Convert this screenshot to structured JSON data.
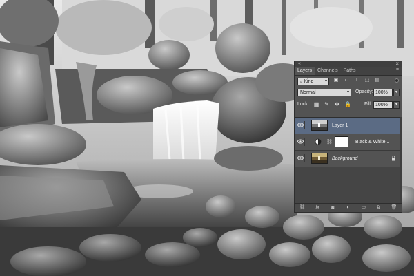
{
  "photo": {
    "subject": "waterfall-in-forest-bw"
  },
  "panel": {
    "tabs": [
      {
        "label": "Layers",
        "active": true
      },
      {
        "label": "Channels",
        "active": false
      },
      {
        "label": "Paths",
        "active": false
      }
    ],
    "filter": {
      "kind_label": "Kind"
    },
    "blend": {
      "mode": "Normal",
      "opacity_label": "Opacity:",
      "opacity_value": "100%"
    },
    "lock": {
      "label": "Lock:",
      "fill_label": "Fill:",
      "fill_value": "100%"
    },
    "layers": [
      {
        "name": "Layer 1",
        "selected": true,
        "visible": true,
        "thumb": "image"
      },
      {
        "name": "Black & White...",
        "selected": false,
        "visible": true,
        "thumb": "adjustment"
      },
      {
        "name": "Background",
        "selected": false,
        "visible": true,
        "thumb": "image-color",
        "locked": true,
        "italic": true
      }
    ]
  }
}
